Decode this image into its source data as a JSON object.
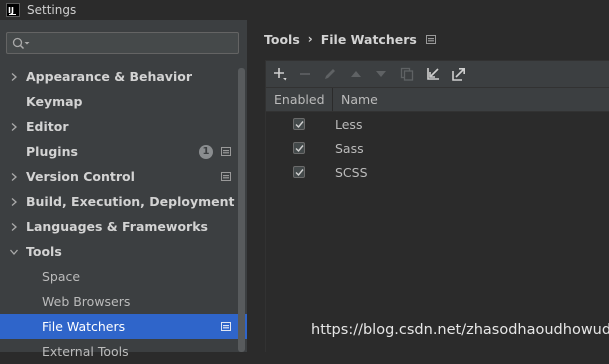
{
  "window": {
    "title": "Settings",
    "logo_text": "IJ"
  },
  "search": {
    "value": "",
    "placeholder": ""
  },
  "sidebar": {
    "items": [
      {
        "label": "Appearance & Behavior",
        "arrow": true
      },
      {
        "label": "Keymap",
        "arrow": false
      },
      {
        "label": "Editor",
        "arrow": true
      },
      {
        "label": "Plugins",
        "arrow": false,
        "badge": "1",
        "project_icon": true
      },
      {
        "label": "Version Control",
        "arrow": true,
        "project_icon": true
      },
      {
        "label": "Build, Execution, Deployment",
        "arrow": true
      },
      {
        "label": "Languages & Frameworks",
        "arrow": true
      },
      {
        "label": "Tools",
        "arrow": true,
        "expanded": true
      },
      {
        "label": "Space",
        "child": true
      },
      {
        "label": "Web Browsers",
        "child": true
      },
      {
        "label": "File Watchers",
        "child": true,
        "selected": true,
        "project_icon": true
      },
      {
        "label": "External Tools",
        "child": true
      }
    ]
  },
  "breadcrumb": {
    "parent": "Tools",
    "separator": "›",
    "current": "File Watchers"
  },
  "toolbar": {
    "buttons": [
      "add-icon",
      "remove-icon",
      "edit-icon",
      "move-up-icon",
      "move-down-icon",
      "copy-icon",
      "import-icon",
      "export-icon"
    ]
  },
  "table": {
    "headers": {
      "enabled": "Enabled",
      "name": "Name"
    },
    "rows": [
      {
        "enabled": true,
        "name": "Less"
      },
      {
        "enabled": true,
        "name": "Sass"
      },
      {
        "enabled": true,
        "name": "SCSS"
      }
    ]
  },
  "watermark": "https://blog.csdn.net/zhasodhaoudhowud",
  "colors": {
    "selection": "#2f65ca",
    "sidebar_bg": "#3c3f41",
    "main_bg": "#2b2b2b"
  }
}
